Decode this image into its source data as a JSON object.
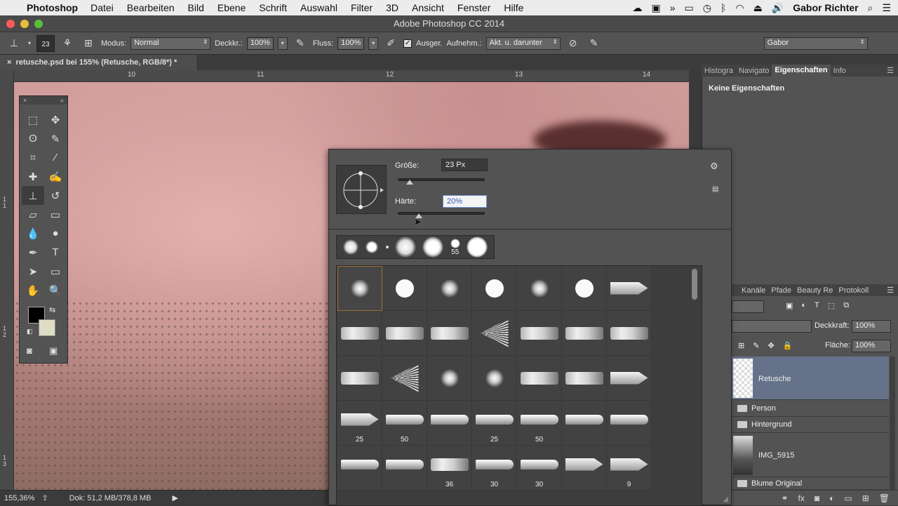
{
  "menubar": {
    "app_name": "Photoshop",
    "items": [
      "Datei",
      "Bearbeiten",
      "Bild",
      "Ebene",
      "Schrift",
      "Auswahl",
      "Filter",
      "3D",
      "Ansicht",
      "Fenster",
      "Hilfe"
    ],
    "user": "Gabor Richter"
  },
  "window": {
    "title": "Adobe Photoshop CC 2014"
  },
  "options": {
    "brush_size": "23",
    "modus_label": "Modus:",
    "modus_value": "Normal",
    "deckkr_label": "Deckkr.:",
    "deckkr_value": "100%",
    "fluss_label": "Fluss:",
    "fluss_value": "100%",
    "ausger_label": "Ausger.",
    "aufnehm_label": "Aufnehm.:",
    "aufnehm_value": "Akt. u. darunter",
    "workspace": "Gabor"
  },
  "document": {
    "tab_title": "retusche.psd bei 155% (Retusche, RGB/8*) *",
    "ruler_h": [
      "10",
      "11",
      "12",
      "13",
      "14"
    ],
    "ruler_v": [
      "1\n1",
      "1\n2",
      "1\n3"
    ],
    "zoom": "155,36%",
    "doc_size": "Dok: 51,2 MB/378,8 MB"
  },
  "right_panel": {
    "tabs": [
      "Histogra",
      "Navigato",
      "Eigenschaften",
      "Info"
    ],
    "active_tab": "Eigenschaften",
    "props_empty": "Keine Eigenschaften"
  },
  "brush_popup": {
    "size_label": "Größe:",
    "size_value": "23 Px",
    "size_fraction": 0.03,
    "hardness_label": "Härte:",
    "hardness_value": "20%",
    "hardness_fraction": 0.2,
    "recent_label": "55",
    "grid_numbers": {
      "r4": [
        "25",
        "50",
        "",
        "25",
        "50",
        "",
        ""
      ],
      "r5": [
        "",
        "",
        "36",
        "30",
        "30",
        "",
        "9"
      ]
    }
  },
  "layers": {
    "tabs": [
      "Kanäle",
      "Pfade",
      "Beauty Re",
      "Protokoll"
    ],
    "deckkraft_label": "Deckkraft:",
    "deckkraft_value": "100%",
    "flaeche_label": "Fläche:",
    "flaeche_value": "100%",
    "items": [
      "Retusche",
      "Person",
      "Hintergrund",
      "IMG_5915",
      "Blume Original"
    ],
    "selected": "Retusche"
  },
  "colors": {
    "accent_selection": "#66728a",
    "foreground": "#000000",
    "background": "#dddcc5"
  }
}
